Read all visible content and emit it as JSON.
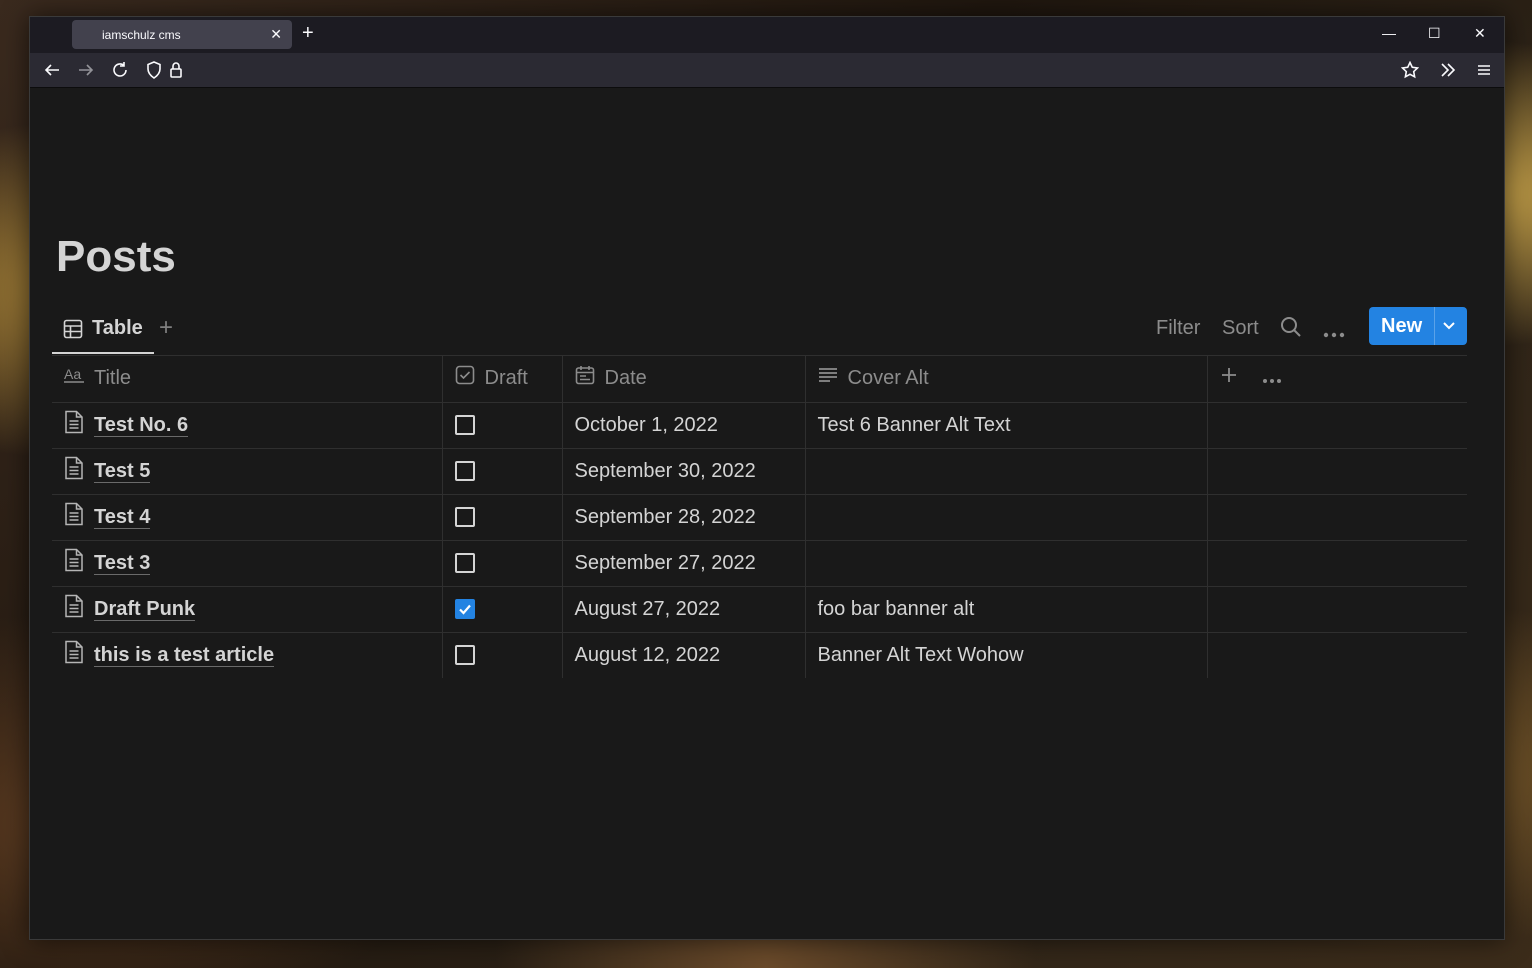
{
  "browser": {
    "tab_title": "iamschulz cms",
    "tab_close": "✕",
    "new_tab": "+",
    "minimize": "—",
    "maximize": "☐",
    "close": "✕"
  },
  "page": {
    "title": "Posts"
  },
  "toolbar": {
    "view_tab_label": "Table",
    "add_view": "+",
    "filter_label": "Filter",
    "sort_label": "Sort",
    "new_label": "New"
  },
  "table": {
    "headers": {
      "title": "Title",
      "draft": "Draft",
      "date": "Date",
      "cover_alt": "Cover Alt"
    },
    "rows": [
      {
        "title": "Test No. 6",
        "draft": false,
        "date": "October 1, 2022",
        "cover_alt": "Test 6 Banner Alt Text"
      },
      {
        "title": "Test 5",
        "draft": false,
        "date": "September 30, 2022",
        "cover_alt": ""
      },
      {
        "title": "Test 4",
        "draft": false,
        "date": "September 28, 2022",
        "cover_alt": ""
      },
      {
        "title": "Test 3",
        "draft": false,
        "date": "September 27, 2022",
        "cover_alt": ""
      },
      {
        "title": "Draft Punk",
        "draft": true,
        "date": "August 27, 2022",
        "cover_alt": "foo bar banner alt"
      },
      {
        "title": "this is a test article",
        "draft": false,
        "date": "August 12, 2022",
        "cover_alt": "Banner Alt Text Wohow"
      }
    ]
  },
  "icons": {
    "back": "arrow-left-icon",
    "forward": "arrow-right-icon",
    "reload": "reload-icon",
    "shield": "shield-icon",
    "lock": "lock-icon",
    "bookmark": "star-icon",
    "extensions": "chevrons-right-icon",
    "menu": "hamburger-menu-icon",
    "table_view": "table-icon",
    "search": "search-icon",
    "more": "more-icon",
    "page": "page-icon",
    "checkbox_prop": "checkbox-icon",
    "calendar": "calendar-icon",
    "text_prop": "text-lines-icon",
    "title_prop": "aa-icon"
  },
  "colors": {
    "accent": "#2383e2",
    "background": "#191919",
    "text": "#d4d4d4",
    "muted": "#8c8c8c"
  }
}
